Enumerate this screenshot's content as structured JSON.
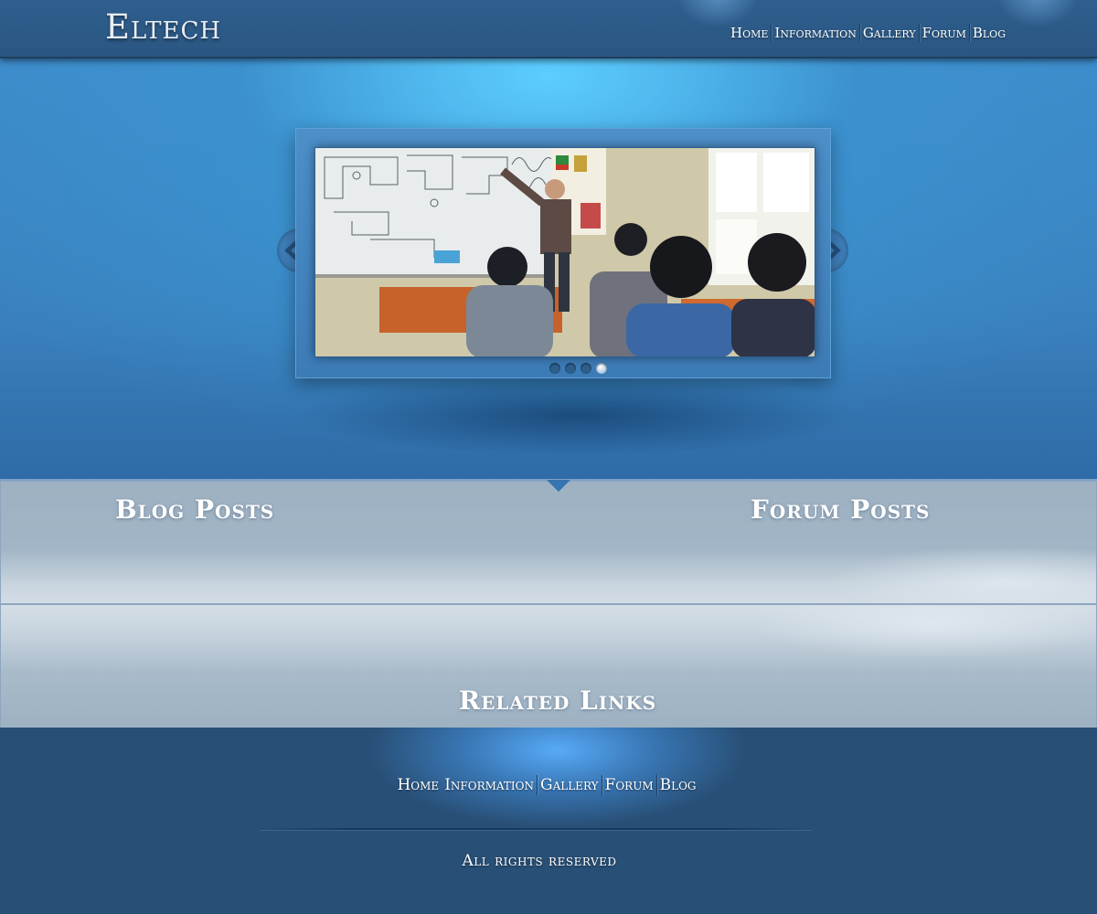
{
  "header": {
    "logo": "Eltech",
    "nav": [
      {
        "label": "Home"
      },
      {
        "label": "Information"
      },
      {
        "label": "Gallery"
      },
      {
        "label": "Forum"
      },
      {
        "label": "Blog"
      }
    ]
  },
  "slider": {
    "prev_icon": "chevron-left-icon",
    "next_icon": "chevron-right-icon",
    "slide_count": 4,
    "active_slide": 4,
    "photo_description_icon": "classroom-photo"
  },
  "sections": {
    "blog_title": "Blog Posts",
    "forum_title": "Forum Posts",
    "related_title": "Related Links"
  },
  "footer": {
    "nav": [
      {
        "label": "Home"
      },
      {
        "label": "Information"
      },
      {
        "label": "Gallery"
      },
      {
        "label": "Forum"
      },
      {
        "label": "Blog"
      }
    ],
    "copyright": "All rights reserved"
  },
  "colors": {
    "header_bg": "#2f5f8e",
    "hero_glow": "#5ccdff",
    "content_bg": "#9cb0c1",
    "footer_bg": "#284f76"
  }
}
